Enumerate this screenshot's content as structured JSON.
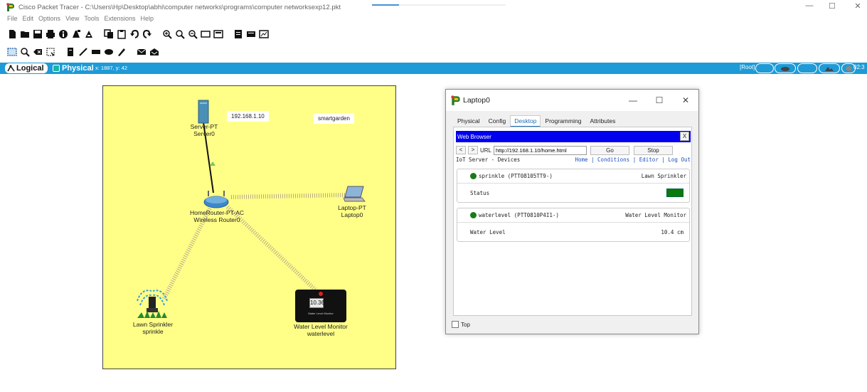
{
  "window": {
    "title": "Cisco Packet Tracer - C:\\Users\\Hp\\Desktop\\abhi\\computer networks\\programs\\computer networksexp12.pkt",
    "minimize": "—",
    "maximize": "☐",
    "close": "✕"
  },
  "menu": [
    "File",
    "Edit",
    "Options",
    "View",
    "Tools",
    "Extensions",
    "Help"
  ],
  "modebar": {
    "logical_label": "Logical",
    "physical_label": "Physical",
    "coords": "x: 1887, y: 42",
    "root_label": "[Root]",
    "time_label": "02:3"
  },
  "canvas": {
    "background": "#ffff88",
    "server": {
      "type_label": "Server-PT",
      "name": "Server0"
    },
    "router": {
      "type_label": "HomeRouter-PT-AC",
      "name": "Wireless Router0"
    },
    "laptop": {
      "type_label": "Laptop-PT",
      "name": "Laptop0"
    },
    "sprinkler": {
      "type_label": "Lawn Sprinkler",
      "name": "sprinkle"
    },
    "water_monitor": {
      "type_label": "Water Level Monitor",
      "name": "waterlevel",
      "display_value": "10.36",
      "badge_text": "Water Level Monitor"
    },
    "note_ip": "192.168.1.10",
    "note_name": "smartgarden"
  },
  "laptop_window": {
    "title": "Laptop0",
    "tabs": [
      "Physical",
      "Config",
      "Desktop",
      "Programming",
      "Attributes"
    ],
    "active_tab": "Desktop",
    "browser": {
      "title": "Web Browser",
      "close": "X",
      "back": "<",
      "forward": ">",
      "url_label": "URL",
      "url_value": "http://192.168.1.10/home.html",
      "go": "Go",
      "stop": "Stop"
    },
    "iot_title": "IoT Server - Devices",
    "iot_links": "Home | Conditions | Editor | Log Out",
    "devices": [
      {
        "name": "sprinkle (PTT08105TT9-)",
        "type": "Lawn Sprinkler",
        "field": "Status",
        "value": "",
        "status_color": "#0a7a0a"
      },
      {
        "name": "waterlevel (PTT0810P4I1-)",
        "type": "Water Level Monitor",
        "field": "Water Level",
        "value": "10.4 cm"
      }
    ],
    "top_label": "Top"
  }
}
